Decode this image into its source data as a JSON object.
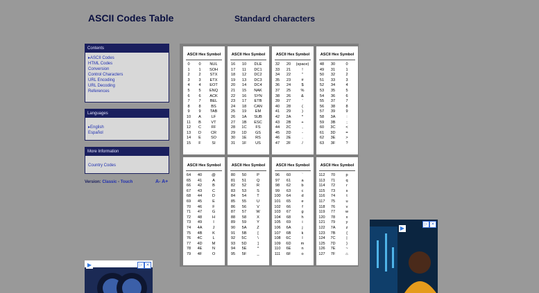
{
  "header": {
    "site_title": "ASCII Codes Table",
    "section_title": "Standard characters"
  },
  "contents_box": {
    "heading": "Contents",
    "links": [
      "ASCII Codes",
      "HTML Codes",
      "Conversion",
      "Control Characters",
      "URL Encoding",
      "URL Decoding",
      "References"
    ]
  },
  "languages_box": {
    "heading": "Languages",
    "links": [
      "English",
      "Español"
    ]
  },
  "info_box": {
    "heading": "More Information",
    "links": [
      "Country Codes"
    ]
  },
  "version": {
    "label": "Version:",
    "classic": "Classic",
    "separator": "-",
    "touch": "Touch"
  },
  "font_size": {
    "small": "A-",
    "large": "A+"
  },
  "table_header": {
    "ascii": "ASCII",
    "hex": "Hex",
    "symbol": "Symbol"
  },
  "panels": [
    {
      "rows": [
        [
          "0",
          "0",
          "NUL"
        ],
        [
          "1",
          "1",
          "SOH"
        ],
        [
          "2",
          "2",
          "STX"
        ],
        [
          "3",
          "3",
          "ETX"
        ],
        [
          "4",
          "4",
          "EOT"
        ],
        [
          "5",
          "5",
          "ENQ"
        ],
        [
          "6",
          "6",
          "ACK"
        ],
        [
          "7",
          "7",
          "BEL"
        ],
        [
          "8",
          "8",
          "BS"
        ],
        [
          "9",
          "9",
          "TAB"
        ],
        [
          "10",
          "A",
          "LF"
        ],
        [
          "11",
          "B",
          "VT"
        ],
        [
          "12",
          "C",
          "FF"
        ],
        [
          "13",
          "D",
          "CR"
        ],
        [
          "14",
          "E",
          "SO"
        ],
        [
          "15",
          "F",
          "SI"
        ]
      ]
    },
    {
      "rows": [
        [
          "16",
          "10",
          "DLE"
        ],
        [
          "17",
          "11",
          "DC1"
        ],
        [
          "18",
          "12",
          "DC2"
        ],
        [
          "19",
          "13",
          "DC3"
        ],
        [
          "20",
          "14",
          "DC4"
        ],
        [
          "21",
          "15",
          "NAK"
        ],
        [
          "22",
          "16",
          "SYN"
        ],
        [
          "23",
          "17",
          "ETB"
        ],
        [
          "24",
          "18",
          "CAN"
        ],
        [
          "25",
          "19",
          "EM"
        ],
        [
          "26",
          "1A",
          "SUB"
        ],
        [
          "27",
          "1B",
          "ESC"
        ],
        [
          "28",
          "1C",
          "FS"
        ],
        [
          "29",
          "1D",
          "GS"
        ],
        [
          "30",
          "1E",
          "RS"
        ],
        [
          "31",
          "1F",
          "US"
        ]
      ]
    },
    {
      "rows": [
        [
          "32",
          "20",
          "(space)"
        ],
        [
          "33",
          "21",
          "!"
        ],
        [
          "34",
          "22",
          "\""
        ],
        [
          "35",
          "23",
          "#"
        ],
        [
          "36",
          "24",
          "$"
        ],
        [
          "37",
          "25",
          "%"
        ],
        [
          "38",
          "26",
          "&"
        ],
        [
          "39",
          "27",
          "'"
        ],
        [
          "40",
          "28",
          "("
        ],
        [
          "41",
          "29",
          ")"
        ],
        [
          "42",
          "2A",
          "*"
        ],
        [
          "43",
          "2B",
          "+"
        ],
        [
          "44",
          "2C",
          ","
        ],
        [
          "45",
          "2D",
          "-"
        ],
        [
          "46",
          "2E",
          "."
        ],
        [
          "47",
          "2F",
          "/"
        ]
      ]
    },
    {
      "rows": [
        [
          "48",
          "30",
          "0"
        ],
        [
          "49",
          "31",
          "1"
        ],
        [
          "50",
          "32",
          "2"
        ],
        [
          "51",
          "33",
          "3"
        ],
        [
          "52",
          "34",
          "4"
        ],
        [
          "53",
          "35",
          "5"
        ],
        [
          "54",
          "36",
          "6"
        ],
        [
          "55",
          "37",
          "7"
        ],
        [
          "56",
          "38",
          "8"
        ],
        [
          "57",
          "39",
          "9"
        ],
        [
          "58",
          "3A",
          ":"
        ],
        [
          "59",
          "3B",
          ";"
        ],
        [
          "60",
          "3C",
          "<"
        ],
        [
          "61",
          "3D",
          "="
        ],
        [
          "62",
          "3E",
          ">"
        ],
        [
          "63",
          "3F",
          "?"
        ]
      ]
    },
    {
      "rows": [
        [
          "64",
          "40",
          "@"
        ],
        [
          "65",
          "41",
          "A"
        ],
        [
          "66",
          "42",
          "B"
        ],
        [
          "67",
          "43",
          "C"
        ],
        [
          "68",
          "44",
          "D"
        ],
        [
          "69",
          "45",
          "E"
        ],
        [
          "70",
          "46",
          "F"
        ],
        [
          "71",
          "47",
          "G"
        ],
        [
          "72",
          "48",
          "H"
        ],
        [
          "73",
          "49",
          "I"
        ],
        [
          "74",
          "4A",
          "J"
        ],
        [
          "75",
          "4B",
          "K"
        ],
        [
          "76",
          "4C",
          "L"
        ],
        [
          "77",
          "4D",
          "M"
        ],
        [
          "78",
          "4E",
          "N"
        ],
        [
          "79",
          "4F",
          "O"
        ]
      ]
    },
    {
      "rows": [
        [
          "80",
          "50",
          "P"
        ],
        [
          "81",
          "51",
          "Q"
        ],
        [
          "82",
          "52",
          "R"
        ],
        [
          "83",
          "53",
          "S"
        ],
        [
          "84",
          "54",
          "T"
        ],
        [
          "85",
          "55",
          "U"
        ],
        [
          "86",
          "56",
          "V"
        ],
        [
          "87",
          "57",
          "W"
        ],
        [
          "88",
          "58",
          "X"
        ],
        [
          "89",
          "59",
          "Y"
        ],
        [
          "90",
          "5A",
          "Z"
        ],
        [
          "91",
          "5B",
          "["
        ],
        [
          "92",
          "5C",
          "\\"
        ],
        [
          "93",
          "5D",
          "]"
        ],
        [
          "94",
          "5E",
          "^"
        ],
        [
          "95",
          "5F",
          "_"
        ]
      ]
    },
    {
      "rows": [
        [
          "96",
          "60",
          "`"
        ],
        [
          "97",
          "61",
          "a"
        ],
        [
          "98",
          "62",
          "b"
        ],
        [
          "99",
          "63",
          "c"
        ],
        [
          "100",
          "64",
          "d"
        ],
        [
          "101",
          "65",
          "e"
        ],
        [
          "102",
          "66",
          "f"
        ],
        [
          "103",
          "67",
          "g"
        ],
        [
          "104",
          "68",
          "h"
        ],
        [
          "105",
          "69",
          "i"
        ],
        [
          "106",
          "6A",
          "j"
        ],
        [
          "107",
          "6B",
          "k"
        ],
        [
          "108",
          "6C",
          "l"
        ],
        [
          "109",
          "6D",
          "m"
        ],
        [
          "110",
          "6E",
          "n"
        ],
        [
          "111",
          "6F",
          "o"
        ]
      ]
    },
    {
      "rows": [
        [
          "112",
          "70",
          "p"
        ],
        [
          "113",
          "71",
          "q"
        ],
        [
          "114",
          "72",
          "r"
        ],
        [
          "115",
          "73",
          "s"
        ],
        [
          "116",
          "74",
          "t"
        ],
        [
          "117",
          "75",
          "u"
        ],
        [
          "118",
          "76",
          "v"
        ],
        [
          "119",
          "77",
          "w"
        ],
        [
          "120",
          "78",
          "x"
        ],
        [
          "121",
          "79",
          "y"
        ],
        [
          "122",
          "7A",
          "z"
        ],
        [
          "123",
          "7B",
          "{"
        ],
        [
          "124",
          "7C",
          "|"
        ],
        [
          "125",
          "7D",
          "}"
        ],
        [
          "126",
          "7E",
          "~"
        ],
        [
          "127",
          "7F",
          "⌂"
        ]
      ]
    }
  ],
  "ads": {
    "close_icon": "close-icon",
    "info_icon": "info-icon",
    "play_icon": "play-icon"
  }
}
